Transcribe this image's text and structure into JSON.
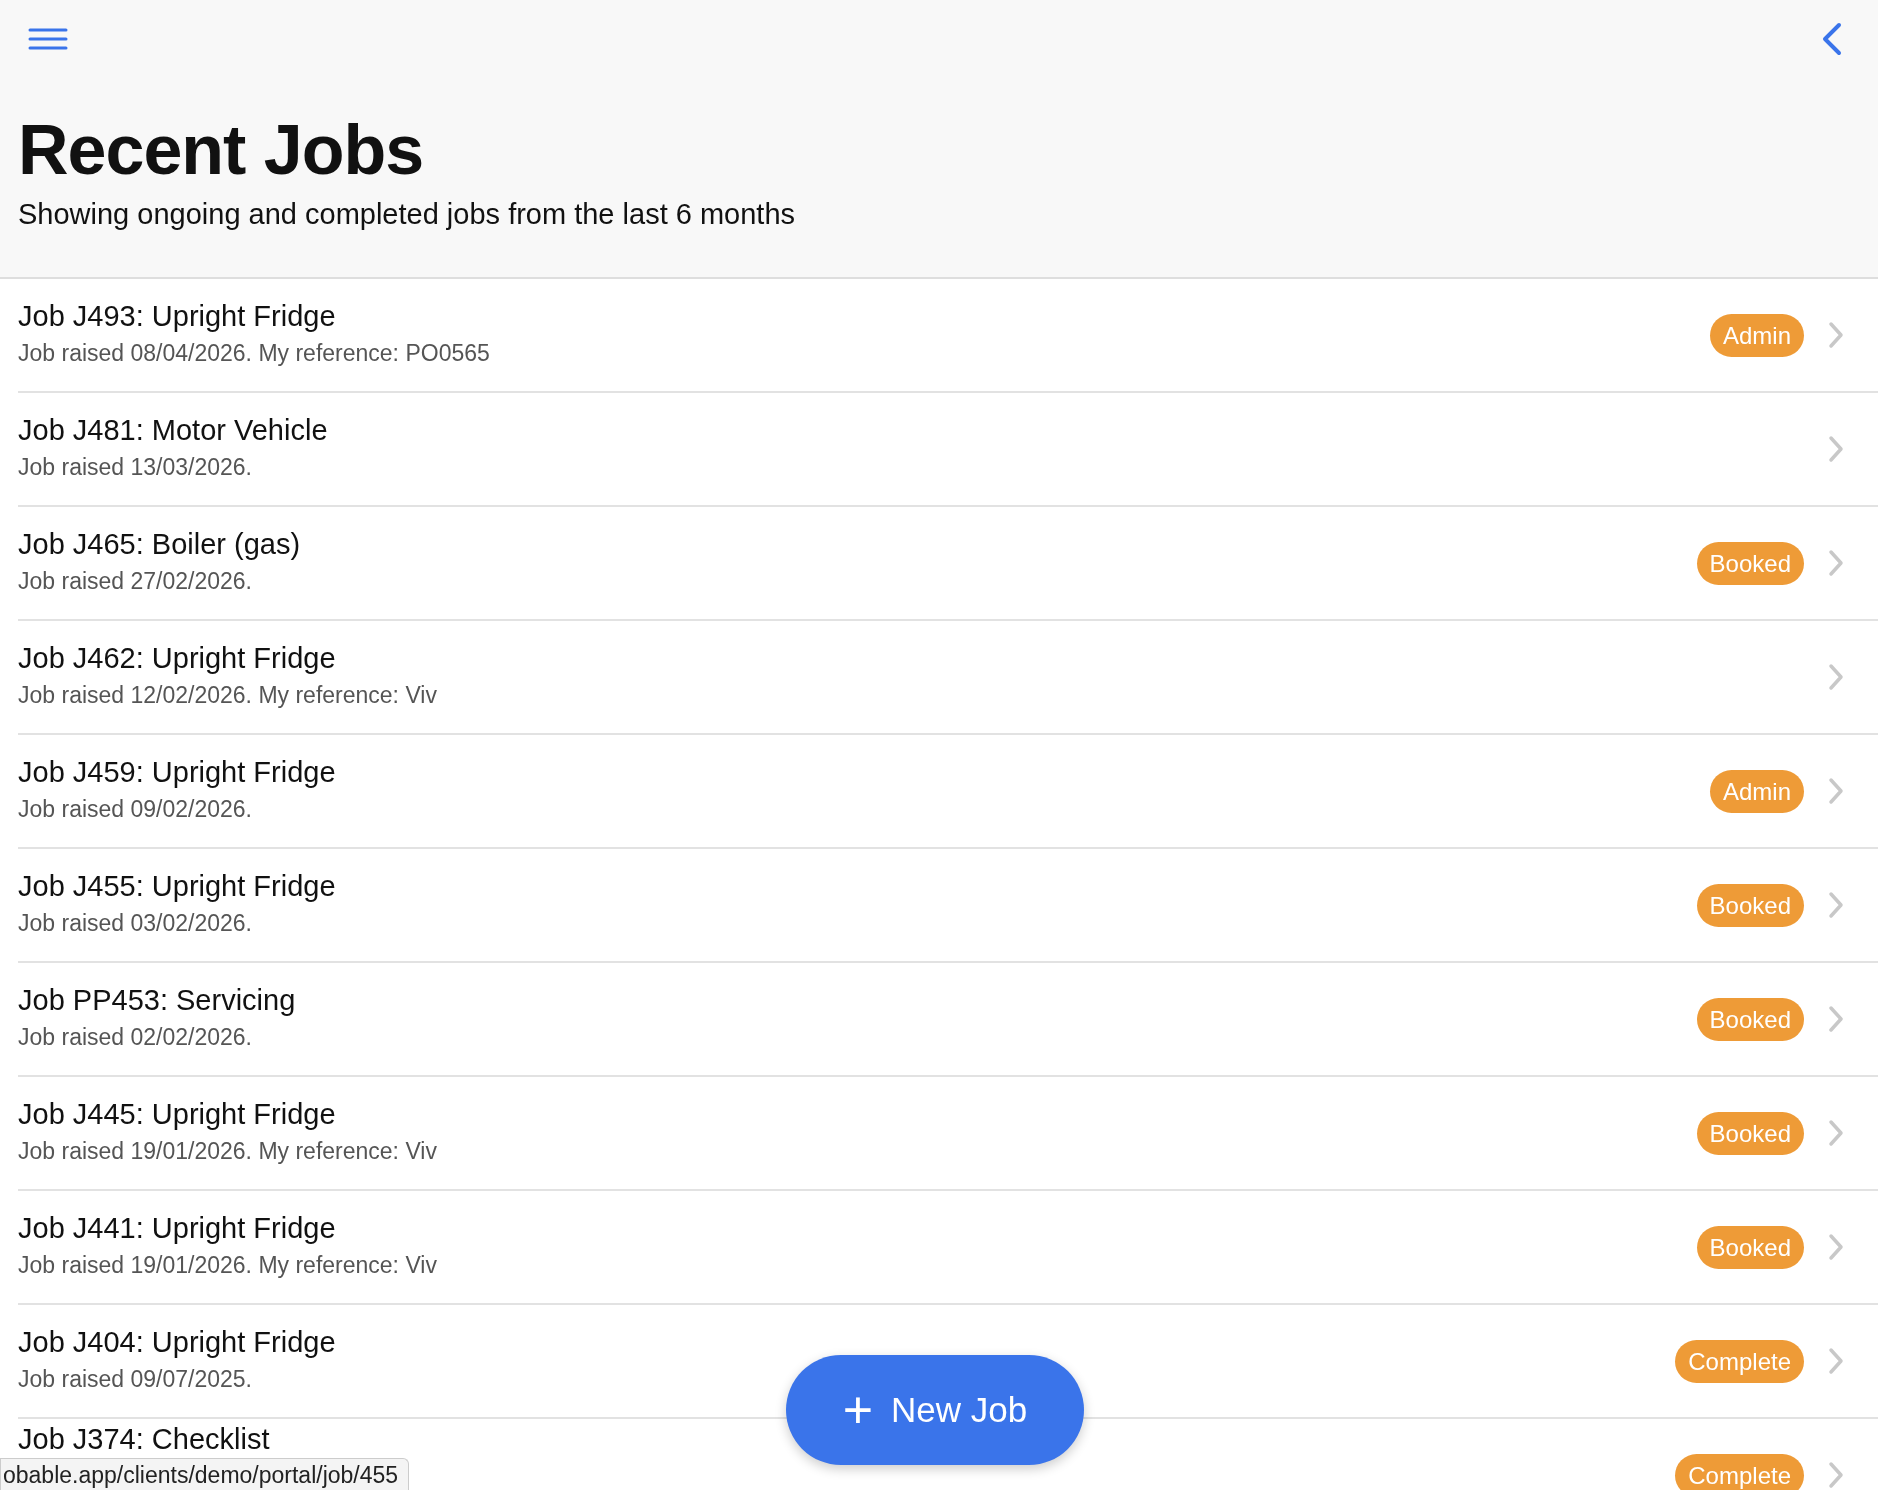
{
  "header": {
    "title": "Recent Jobs",
    "subtitle": "Showing ongoing and completed jobs from the last 6 months"
  },
  "jobs": [
    {
      "title": "Job J493: Upright Fridge",
      "detail": "Job raised 08/04/2026. My reference: PO0565",
      "status": "Admin"
    },
    {
      "title": "Job J481: Motor Vehicle",
      "detail": "Job raised 13/03/2026."
    },
    {
      "title": "Job J465: Boiler (gas)",
      "detail": "Job raised 27/02/2026.",
      "status": "Booked"
    },
    {
      "title": "Job J462: Upright Fridge",
      "detail": "Job raised 12/02/2026. My reference: Viv"
    },
    {
      "title": "Job J459: Upright Fridge",
      "detail": "Job raised 09/02/2026.",
      "status": "Admin"
    },
    {
      "title": "Job J455: Upright Fridge",
      "detail": "Job raised 03/02/2026.",
      "status": "Booked"
    },
    {
      "title": "Job PP453: Servicing",
      "detail": "Job raised 02/02/2026.",
      "status": "Booked"
    },
    {
      "title": "Job J445: Upright Fridge",
      "detail": "Job raised 19/01/2026. My reference: Viv",
      "status": "Booked"
    },
    {
      "title": "Job J441: Upright Fridge",
      "detail": "Job raised 19/01/2026. My reference: Viv",
      "status": "Booked"
    },
    {
      "title": "Job J404: Upright Fridge",
      "detail": "Job raised 09/07/2025.",
      "status": "Complete"
    },
    {
      "title": "Job J374: Checklist",
      "status": "Complete"
    }
  ],
  "new_job_button": {
    "icon": "+",
    "label": "New Job"
  },
  "status_url": "obable.app/clients/demo/portal/job/455"
}
